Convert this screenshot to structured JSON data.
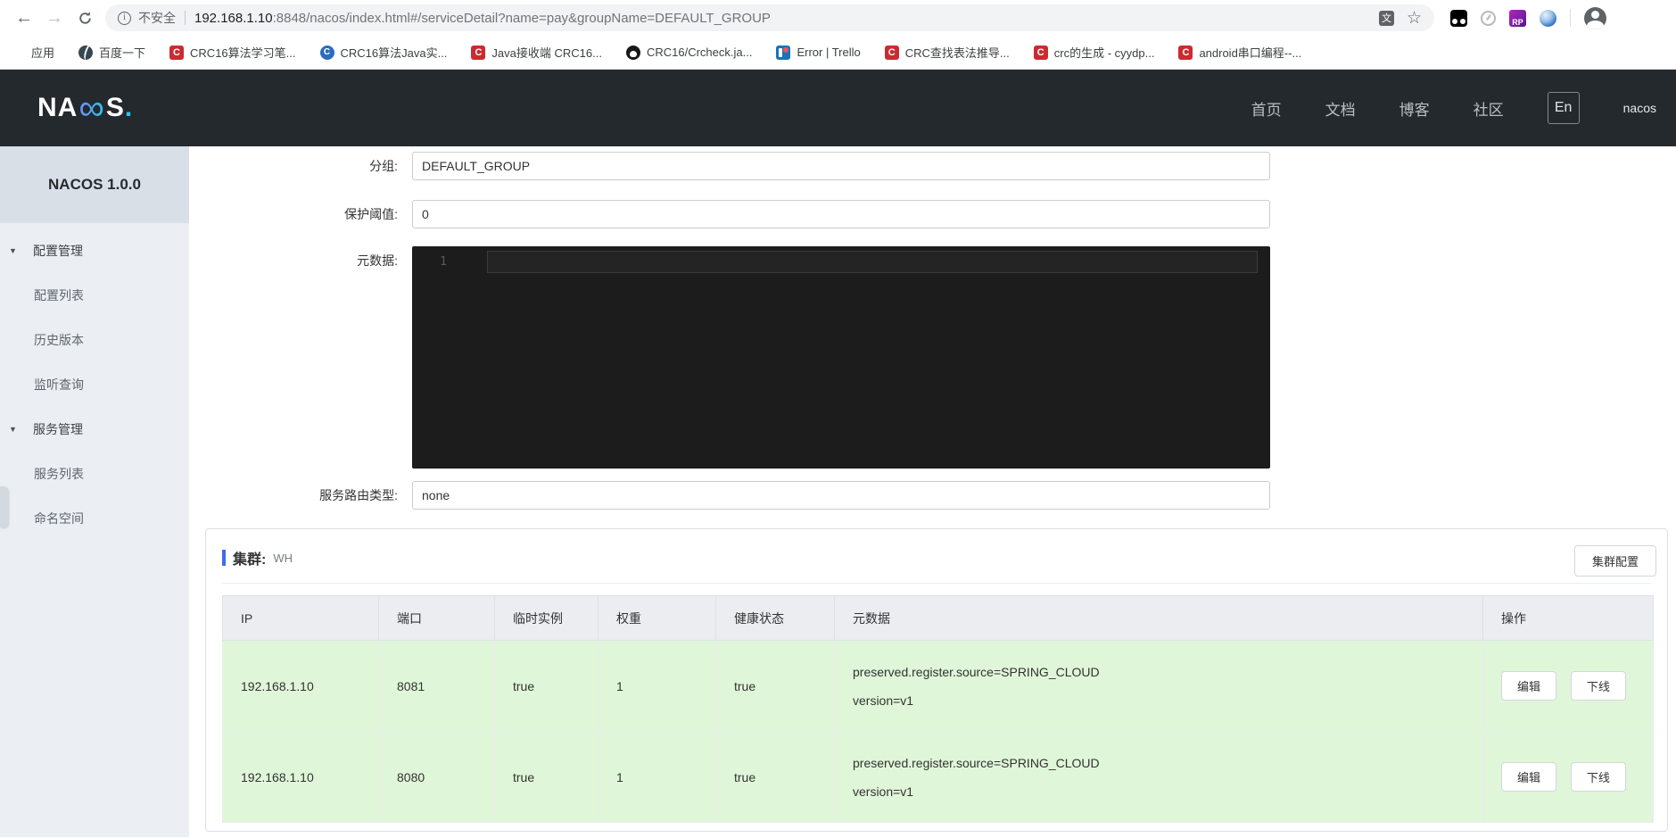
{
  "browser": {
    "security_text": "不安全",
    "url_host": "192.168.1.10",
    "url_path": ":8848/nacos/index.html#/serviceDetail?name=pay&groupName=DEFAULT_GROUP",
    "bookmarks": [
      {
        "label": "应用",
        "icon": "apps-grid-icon"
      },
      {
        "label": "百度一下",
        "icon": "globe-icon"
      },
      {
        "label": "CRC16算法学习笔...",
        "icon": "csdn-icon",
        "glyph": "C"
      },
      {
        "label": "CRC16算法Java实...",
        "icon": "blue-c-icon",
        "glyph": "C"
      },
      {
        "label": "Java接收端 CRC16...",
        "icon": "csdn-icon",
        "glyph": "C"
      },
      {
        "label": "CRC16/Crcheck.ja...",
        "icon": "github-icon"
      },
      {
        "label": "Error | Trello",
        "icon": "trello-icon"
      },
      {
        "label": "CRC查找表法推导...",
        "icon": "csdn-icon",
        "glyph": "C"
      },
      {
        "label": "crc的生成 - cyydp...",
        "icon": "csdn-icon",
        "glyph": "C"
      },
      {
        "label": "android串口编程--...",
        "icon": "csdn-icon",
        "glyph": "C"
      }
    ]
  },
  "navbar": {
    "logo_left": "NA",
    "logo_infinity": "∞",
    "logo_right": "S",
    "logo_dot": ".",
    "links": [
      {
        "label": "首页"
      },
      {
        "label": "文档"
      },
      {
        "label": "博客"
      },
      {
        "label": "社区"
      }
    ],
    "lang_button": "En",
    "user": "nacos"
  },
  "sidebar": {
    "title": "NACOS 1.0.0",
    "sections": [
      {
        "label": "配置管理",
        "items": [
          {
            "label": "配置列表"
          },
          {
            "label": "历史版本"
          },
          {
            "label": "监听查询"
          }
        ]
      },
      {
        "label": "服务管理",
        "items": [
          {
            "label": "服务列表"
          },
          {
            "label": "命名空间"
          }
        ]
      }
    ]
  },
  "form": {
    "group": {
      "label": "分组:",
      "value": "DEFAULT_GROUP"
    },
    "threshold": {
      "label": "保护阈值:",
      "value": "0"
    },
    "metadata": {
      "label": "元数据:",
      "value": "",
      "line_number": "1"
    },
    "route_type": {
      "label": "服务路由类型:",
      "value": "none"
    }
  },
  "cluster": {
    "title": "集群:",
    "name": "WH",
    "config_button": "集群配置",
    "columns": {
      "ip": "IP",
      "port": "端口",
      "ephemeral": "临时实例",
      "weight": "权重",
      "healthy": "健康状态",
      "metadata": "元数据",
      "actions": "操作"
    },
    "rows": [
      {
        "ip": "192.168.1.10",
        "port": "8081",
        "ephemeral": "true",
        "weight": "1",
        "healthy": "true",
        "metadata_line1": "preserved.register.source=SPRING_CLOUD",
        "metadata_line2": "version=v1",
        "edit_button": "编辑",
        "offline_button": "下线"
      },
      {
        "ip": "192.168.1.10",
        "port": "8080",
        "ephemeral": "true",
        "weight": "1",
        "healthy": "true",
        "metadata_line1": "preserved.register.source=SPRING_CLOUD",
        "metadata_line2": "version=v1",
        "edit_button": "编辑",
        "offline_button": "下线"
      }
    ]
  },
  "colors": {
    "accent_blue": "#3e6bf2",
    "header_dark": "#24292e",
    "row_green": "#e0f6d8",
    "csdn_red": "#ca2b31"
  }
}
